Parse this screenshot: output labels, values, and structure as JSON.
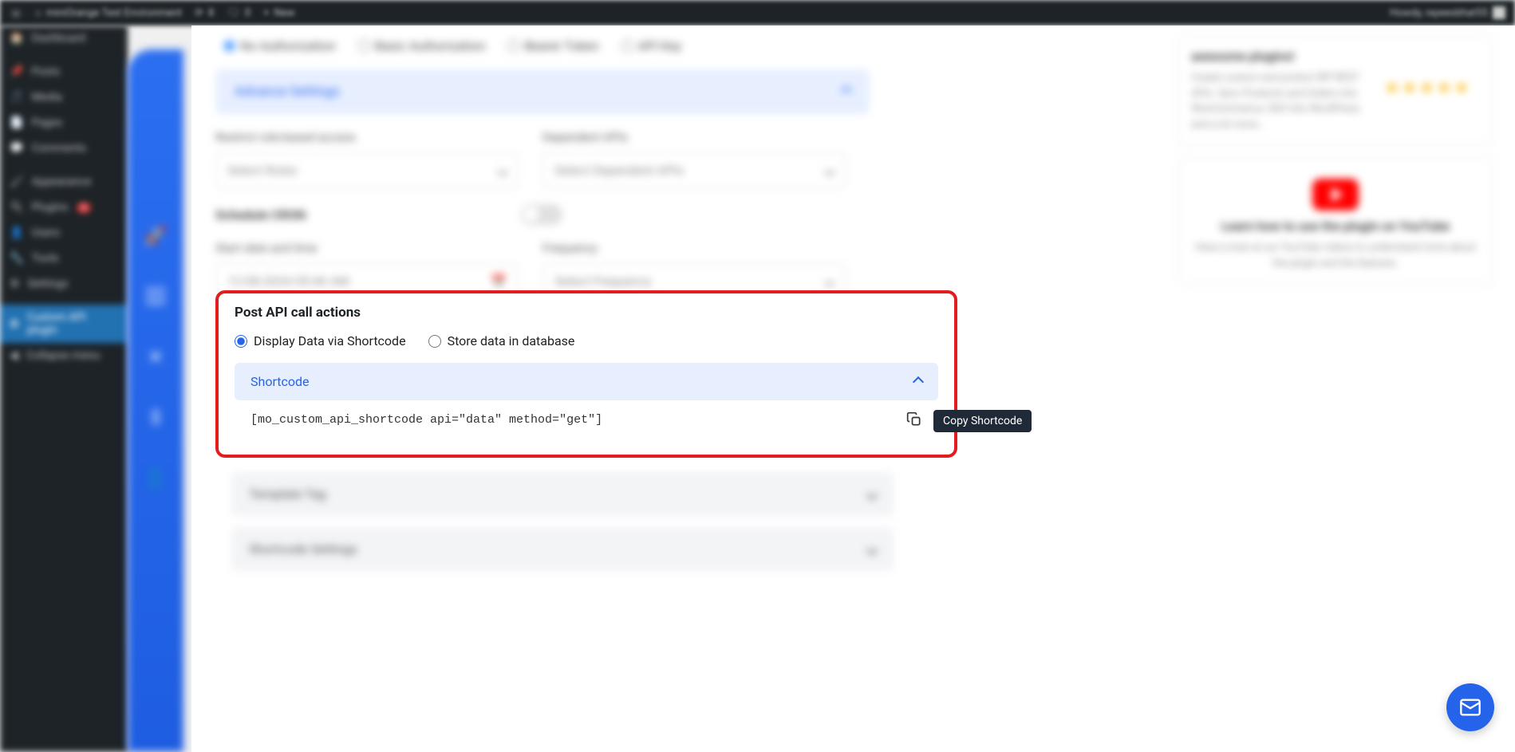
{
  "adminBar": {
    "siteName": "miniOrange Test Environment",
    "updates": "8",
    "comments": "0",
    "new": "New",
    "howdy": "Howdy, rayeesbhat55"
  },
  "sidebar": {
    "items": [
      {
        "label": "Dashboard"
      },
      {
        "label": "Posts"
      },
      {
        "label": "Media"
      },
      {
        "label": "Pages"
      },
      {
        "label": "Comments"
      },
      {
        "label": "Appearance"
      },
      {
        "label": "Plugins",
        "badge": "5"
      },
      {
        "label": "Users"
      },
      {
        "label": "Tools"
      },
      {
        "label": "Settings"
      },
      {
        "label": "Custom API plugin",
        "active": true
      },
      {
        "label": "Collapse menu"
      }
    ]
  },
  "auth": {
    "noAuth": "No Authorization",
    "basic": "Basic Authorization",
    "bearer": "Bearer Token",
    "apiKey": "API Key"
  },
  "advance": {
    "title": "Advance Settings",
    "restrictLabel": "Restrict role-based access",
    "restrictPlaceholder": "Select Roles",
    "dependentLabel": "Dependent APIs",
    "dependentPlaceholder": "Select Dependent APIs",
    "cronLabel": "Schedule CRON",
    "dateLabel": "Start date and time",
    "dateValue": "12-08-2024 05:46 AM",
    "freqLabel": "Frequency",
    "freqPlaceholder": "Select Frequency"
  },
  "focused": {
    "heading": "Post API call actions",
    "opt1": "Display Data via Shortcode",
    "opt2": "Store data in database",
    "shortcodeHeader": "Shortcode",
    "shortcodeValue": "[mo_custom_api_shortcode api=\"data\" method=\"get\"]",
    "tooltip": "Copy Shortcode"
  },
  "bottomCards": {
    "template": "Template Tag",
    "settings": "Shortcode Settings"
  },
  "rightPanel": {
    "awesomeTitle": "awesome plugins!",
    "awesomeText": "Create custom and protect WP REST APIs. Sync Products and Orders into WooCommerce, SSO into WordPress and a lot more...",
    "ytTitle": "Learn how to use the plugin on YouTube",
    "ytText": "Have a look at our YouTube videos to understand more about the plugin and the features."
  }
}
